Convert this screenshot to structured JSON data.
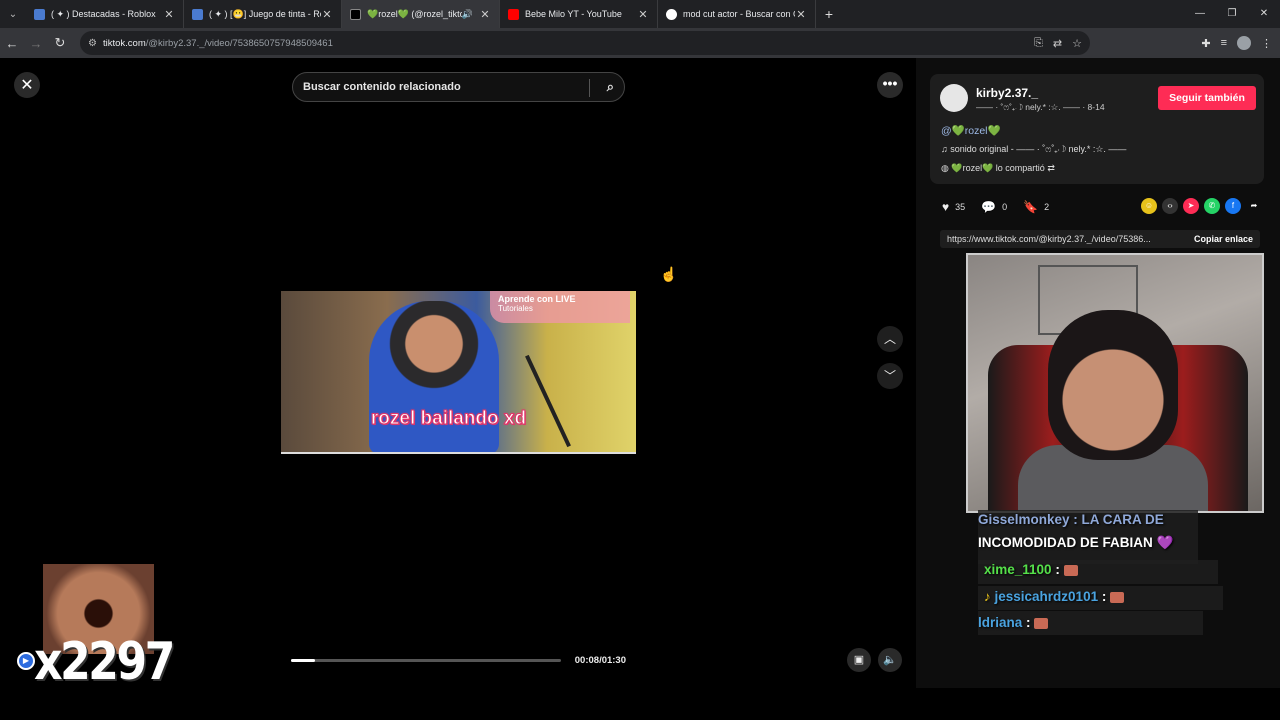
{
  "browser": {
    "tabs": [
      {
        "title": "( ✦ ) Destacadas - Roblox",
        "favicon_color": "#4a7bd0"
      },
      {
        "title": "( ✦ ) [😬] Juego de tinta - Roblox",
        "favicon_color": "#4a7bd0"
      },
      {
        "title": "💚rozel💚 (@rozel_tiktok)",
        "favicon_color": "#000000",
        "active": true
      },
      {
        "title": "Bebe Milo YT - YouTube",
        "favicon_color": "#ff0000"
      },
      {
        "title": "mod cut actor - Buscar con Google",
        "favicon_color": "#ffffff"
      }
    ],
    "url_host": "tiktok.com",
    "url_path": "/@kirby2.37._/video/7538650757948509461"
  },
  "player": {
    "search_placeholder": "Buscar contenido relacionado",
    "live_badge_title": "Aprende con LIVE",
    "live_badge_sub": "Tutoriales",
    "caption": "rozel bailando xd",
    "time": "00:08/01:30",
    "progress": 0.09
  },
  "side": {
    "username": "kirby2.37._",
    "subtitle": "—— · ˚ෆ˚₊‧☽ nely.* :☆. —— · 8-14",
    "follow_label": "Seguir también",
    "mention": "@💚rozel💚",
    "sound": "sonido original - —— · ˚ෆ˚₊‧☽ nely.* :☆. ——",
    "shared": "💚rozel💚 lo compartió",
    "likes": "35",
    "comments": "0",
    "saves": "2",
    "link": "https://www.tiktok.com/@kirby2.37._/video/75386...",
    "copy_label": "Copiar enlace"
  },
  "chat": {
    "line1": "Gisselmonkey : LA CARA DE",
    "line2": "INCOMODIDAD DE FABIAN 💜",
    "line3_user": "xime_1100",
    "line4_user": "jessicahrdz0101",
    "line5_user": "ldriana",
    "colors": {
      "gissel": "#8fa8d8",
      "xime": "#55e04a",
      "jessica": "#4aa3e0",
      "adriana": "#4aa3e0"
    }
  },
  "stream_overlay": {
    "number": "x2297"
  }
}
